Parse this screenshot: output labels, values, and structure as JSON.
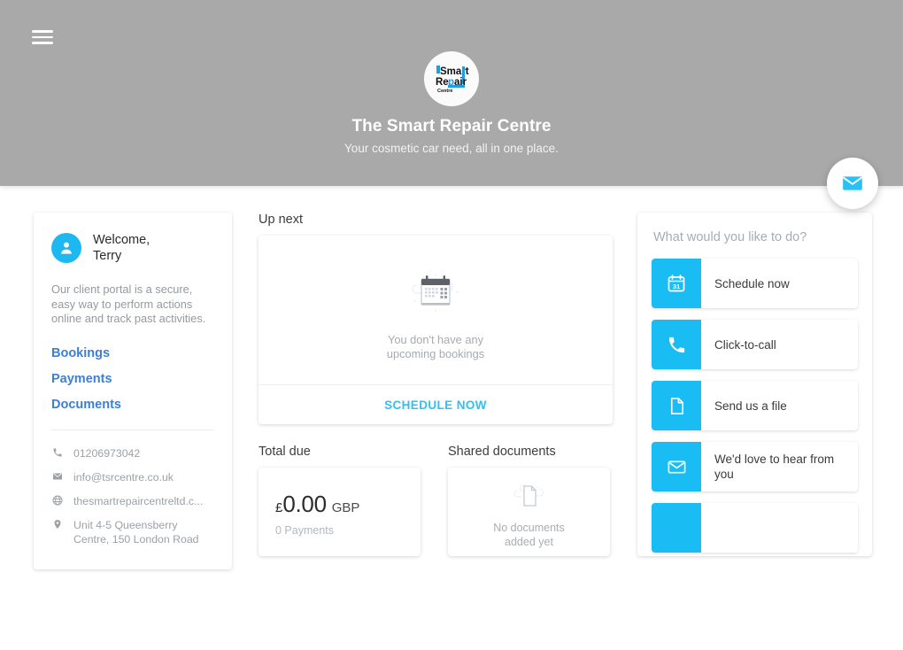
{
  "header": {
    "menu_icon": "hamburger-icon",
    "logo": {
      "icon": "smart-repair-centre-logo",
      "line1": "Smart",
      "line2": "Repair",
      "line3": "Centre"
    },
    "title": "The Smart Repair Centre",
    "tagline": "Your cosmetic car need, all in one place.",
    "background_color": "#a9a9a9"
  },
  "fab": {
    "icon": "envelope-icon",
    "color": "#26c2f5"
  },
  "sidebar": {
    "avatar_icon": "user-avatar-icon",
    "welcome_line1": "Welcome,",
    "welcome_line2": "Terry",
    "blurb": "Our client portal is a secure, easy way to perform actions online and track past activities.",
    "links": [
      {
        "label": "Bookings",
        "name": "bookings"
      },
      {
        "label": "Payments",
        "name": "payments"
      },
      {
        "label": "Documents",
        "name": "documents"
      }
    ],
    "link_color": "#3b7fd9",
    "contact": [
      {
        "icon": "phone-icon",
        "value": "01206973042"
      },
      {
        "icon": "mail-icon",
        "value": "info@tsrcentre.co.uk"
      },
      {
        "icon": "globe-icon",
        "value": "thesmartrepaircentreltd.c..."
      },
      {
        "icon": "location-pin-icon",
        "value": "Unit 4-5 Queensberry Centre, 150 London Road"
      }
    ]
  },
  "up_next": {
    "heading": "Up next",
    "empty_icon": "calendar-empty-icon",
    "empty_line1": "You don't have any",
    "empty_line2": "upcoming bookings",
    "cta": "SCHEDULE NOW",
    "cta_color": "#2ec1f5"
  },
  "total_due": {
    "heading": "Total due",
    "currency_symbol": "£",
    "amount": "0.00",
    "currency_code": "GBP",
    "payments_count": "0 Payments"
  },
  "shared_documents": {
    "heading": "Shared documents",
    "empty_icon": "document-empty-icon",
    "empty_line1": "No documents",
    "empty_line2": "added yet"
  },
  "actions": {
    "title": "What would you like to do?",
    "accent_color": "#19bdf3",
    "items": [
      {
        "icon": "calendar-31-icon",
        "label": "Schedule now"
      },
      {
        "icon": "phone-icon",
        "label": "Click-to-call"
      },
      {
        "icon": "file-icon",
        "label": "Send us a file"
      },
      {
        "icon": "envelope-icon",
        "label": "We'd love to hear from you"
      },
      {
        "icon": "partial-icon",
        "label": ""
      }
    ]
  }
}
